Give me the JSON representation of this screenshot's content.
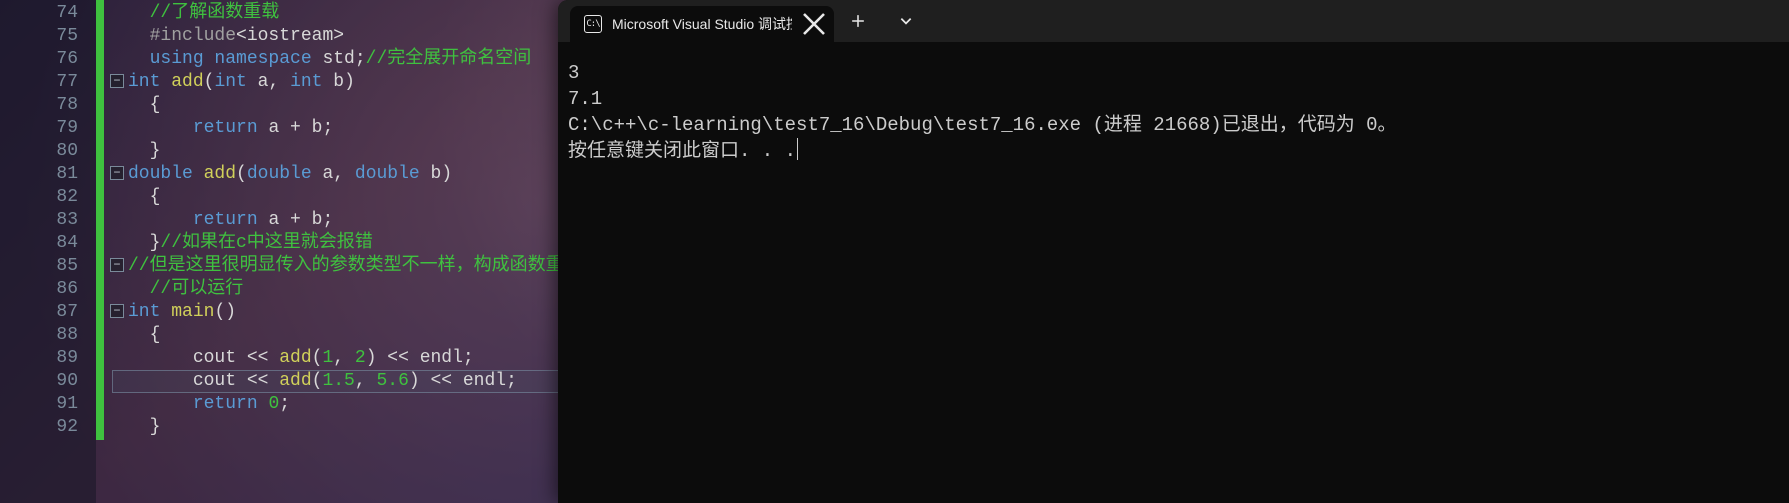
{
  "editor": {
    "first_line_number": 74,
    "highlighted_line_number": 90,
    "lines": [
      {
        "n": 74,
        "fold": "",
        "seg": [
          {
            "t": "  ",
            "c": "c-plain"
          },
          {
            "t": "//了解函数重载",
            "c": "c-comment"
          }
        ]
      },
      {
        "n": 75,
        "fold": "",
        "seg": [
          {
            "t": "  ",
            "c": "c-plain"
          },
          {
            "t": "#include",
            "c": "c-preproc"
          },
          {
            "t": "<iostream>",
            "c": "c-plain"
          }
        ]
      },
      {
        "n": 76,
        "fold": "",
        "seg": [
          {
            "t": "  ",
            "c": "c-plain"
          },
          {
            "t": "using ",
            "c": "c-keyword"
          },
          {
            "t": "namespace ",
            "c": "c-keyword"
          },
          {
            "t": "std",
            "c": "c-plain"
          },
          {
            "t": ";",
            "c": "c-plain"
          },
          {
            "t": "//完全展开命名空间",
            "c": "c-comment"
          }
        ]
      },
      {
        "n": 77,
        "fold": "-",
        "seg": [
          {
            "t": "int ",
            "c": "c-type"
          },
          {
            "t": "add",
            "c": "c-func"
          },
          {
            "t": "(",
            "c": "c-plain"
          },
          {
            "t": "int ",
            "c": "c-type"
          },
          {
            "t": "a",
            "c": "c-plain"
          },
          {
            "t": ", ",
            "c": "c-plain"
          },
          {
            "t": "int ",
            "c": "c-type"
          },
          {
            "t": "b",
            "c": "c-plain"
          },
          {
            "t": ")",
            "c": "c-plain"
          }
        ]
      },
      {
        "n": 78,
        "fold": "",
        "seg": [
          {
            "t": "  {",
            "c": "c-plain"
          }
        ]
      },
      {
        "n": 79,
        "fold": "",
        "seg": [
          {
            "t": "      ",
            "c": "c-plain"
          },
          {
            "t": "return ",
            "c": "c-keyword"
          },
          {
            "t": "a + b;",
            "c": "c-plain"
          }
        ]
      },
      {
        "n": 80,
        "fold": "",
        "seg": [
          {
            "t": "  }",
            "c": "c-plain"
          }
        ]
      },
      {
        "n": 81,
        "fold": "-",
        "seg": [
          {
            "t": "double ",
            "c": "c-type"
          },
          {
            "t": "add",
            "c": "c-func"
          },
          {
            "t": "(",
            "c": "c-plain"
          },
          {
            "t": "double ",
            "c": "c-type"
          },
          {
            "t": "a",
            "c": "c-plain"
          },
          {
            "t": ", ",
            "c": "c-plain"
          },
          {
            "t": "double ",
            "c": "c-type"
          },
          {
            "t": "b",
            "c": "c-plain"
          },
          {
            "t": ")",
            "c": "c-plain"
          }
        ]
      },
      {
        "n": 82,
        "fold": "",
        "seg": [
          {
            "t": "  {",
            "c": "c-plain"
          }
        ]
      },
      {
        "n": 83,
        "fold": "",
        "seg": [
          {
            "t": "      ",
            "c": "c-plain"
          },
          {
            "t": "return ",
            "c": "c-keyword"
          },
          {
            "t": "a + b;",
            "c": "c-plain"
          }
        ]
      },
      {
        "n": 84,
        "fold": "",
        "seg": [
          {
            "t": "  }",
            "c": "c-plain"
          },
          {
            "t": "//如果在c中这里就会报错",
            "c": "c-comment"
          }
        ]
      },
      {
        "n": 85,
        "fold": "-",
        "seg": [
          {
            "t": "//但是这里很明显传入的参数类型不一样，构成函数重载",
            "c": "c-comment"
          }
        ]
      },
      {
        "n": 86,
        "fold": "",
        "seg": [
          {
            "t": "  ",
            "c": "c-plain"
          },
          {
            "t": "//可以运行",
            "c": "c-comment"
          }
        ]
      },
      {
        "n": 87,
        "fold": "-",
        "seg": [
          {
            "t": "int ",
            "c": "c-type"
          },
          {
            "t": "main",
            "c": "c-func"
          },
          {
            "t": "()",
            "c": "c-plain"
          }
        ]
      },
      {
        "n": 88,
        "fold": "",
        "seg": [
          {
            "t": "  {",
            "c": "c-plain"
          }
        ]
      },
      {
        "n": 89,
        "fold": "",
        "seg": [
          {
            "t": "      ",
            "c": "c-plain"
          },
          {
            "t": "cout << ",
            "c": "c-plain"
          },
          {
            "t": "add",
            "c": "c-func"
          },
          {
            "t": "(",
            "c": "c-plain"
          },
          {
            "t": "1",
            "c": "c-num"
          },
          {
            "t": ", ",
            "c": "c-plain"
          },
          {
            "t": "2",
            "c": "c-num"
          },
          {
            "t": ") << endl;",
            "c": "c-plain"
          }
        ]
      },
      {
        "n": 90,
        "fold": "",
        "seg": [
          {
            "t": "      ",
            "c": "c-plain"
          },
          {
            "t": "cout << ",
            "c": "c-plain"
          },
          {
            "t": "add",
            "c": "c-func"
          },
          {
            "t": "(",
            "c": "c-plain"
          },
          {
            "t": "1.5",
            "c": "c-num"
          },
          {
            "t": ", ",
            "c": "c-plain"
          },
          {
            "t": "5.6",
            "c": "c-num"
          },
          {
            "t": ") << endl;",
            "c": "c-plain"
          }
        ]
      },
      {
        "n": 91,
        "fold": "",
        "seg": [
          {
            "t": "      ",
            "c": "c-plain"
          },
          {
            "t": "return ",
            "c": "c-keyword"
          },
          {
            "t": "0",
            "c": "c-num"
          },
          {
            "t": ";",
            "c": "c-plain"
          }
        ]
      },
      {
        "n": 92,
        "fold": "",
        "seg": [
          {
            "t": "  }",
            "c": "c-plain"
          }
        ]
      }
    ]
  },
  "terminal": {
    "tab_icon_text": "C:\\",
    "tab_title": "Microsoft Visual Studio 调试控",
    "output_lines": [
      "3",
      "7.1",
      "",
      "C:\\c++\\c-learning\\test7_16\\Debug\\test7_16.exe (进程 21668)已退出，代码为 0。",
      "按任意键关闭此窗口. . ."
    ]
  }
}
